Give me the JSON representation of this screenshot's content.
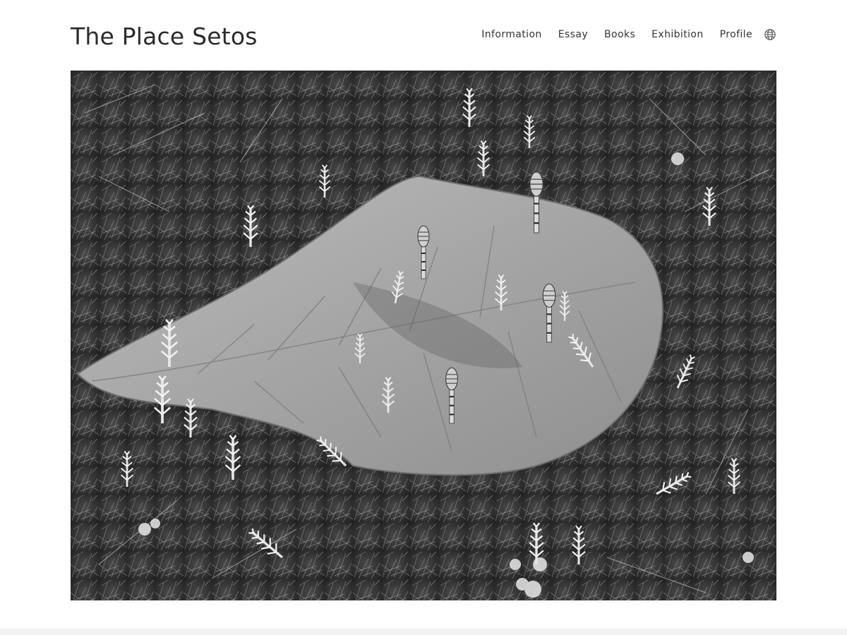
{
  "site": {
    "title": "The Place Setos"
  },
  "nav": {
    "items": [
      {
        "label": "Information"
      },
      {
        "label": "Essay"
      },
      {
        "label": "Books"
      },
      {
        "label": "Exhibition"
      },
      {
        "label": "Profile"
      }
    ],
    "language_icon": "globe-icon"
  },
  "hero": {
    "subject": "black-and-white photograph of a fallen leaf among field horsetail shoots"
  },
  "colors": {
    "text": "#2b2b2b",
    "nav_text": "#333333",
    "background": "#ffffff",
    "footer": "#f2f2f2"
  }
}
